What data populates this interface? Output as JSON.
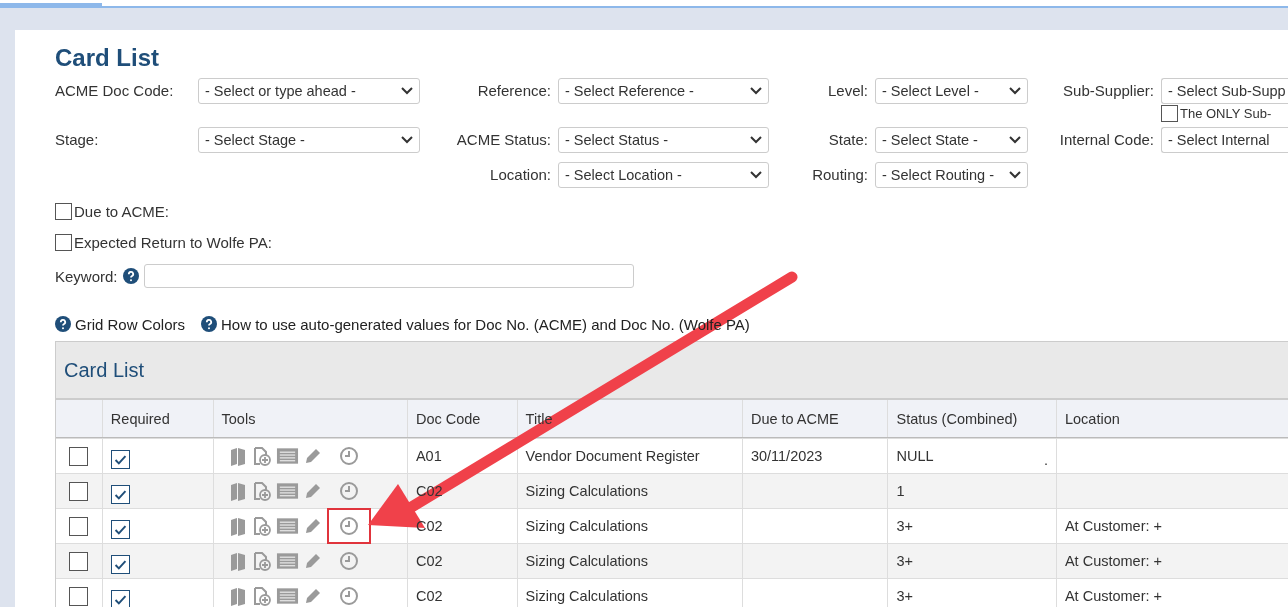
{
  "page_title": "Card List",
  "filter_columns": [
    {
      "fields": [
        {
          "label": "ACME Doc Code:",
          "value": "- Select or type ahead -"
        },
        {
          "label": "Stage:",
          "value": "- Select Stage -"
        }
      ]
    },
    {
      "fields": [
        {
          "label": "Reference:",
          "value": "- Select Reference -"
        },
        {
          "label": "ACME Status:",
          "value": "- Select Status -"
        },
        {
          "label": "Location:",
          "value": "- Select Location -"
        }
      ]
    },
    {
      "fields": [
        {
          "label": "Level:",
          "value": "- Select Level -"
        },
        {
          "label": "State:",
          "value": "- Select State -"
        },
        {
          "label": "Routing:",
          "value": "- Select Routing -"
        }
      ]
    },
    {
      "fields": [
        {
          "label": "Sub-Supplier:",
          "value": "- Select Sub-Supp",
          "extra_checkbox": {
            "label": "The ONLY Sub-",
            "checked": false
          }
        },
        {
          "label": "Internal Code:",
          "value": "- Select Internal"
        }
      ]
    }
  ],
  "checkbox_filters": [
    {
      "label": "Due to ACME:",
      "checked": false
    },
    {
      "label": "Expected Return to Wolfe PA:",
      "checked": false
    }
  ],
  "keyword": {
    "label": "Keyword:"
  },
  "help_links": [
    "Grid Row Colors",
    "How to use auto-generated values for Doc No. (ACME) and Doc No. (Wolfe PA)"
  ],
  "grid": {
    "title": "Card List",
    "columns": [
      "Required",
      "Tools",
      "Doc Code",
      "Title",
      "Due to ACME",
      "Status (Combined)",
      "Location"
    ],
    "rows": [
      {
        "selected": false,
        "required": true,
        "highlighted": false,
        "doc_code": "A01",
        "title": "Vendor Document Register",
        "due": "30/11/2023",
        "status": "NULL",
        "status_note": ".",
        "location": ""
      },
      {
        "selected": false,
        "required": true,
        "highlighted": false,
        "doc_code": "C02",
        "title": "Sizing Calculations",
        "due": "",
        "status": "1",
        "location": ""
      },
      {
        "selected": false,
        "required": true,
        "highlighted": true,
        "doc_code": "C02",
        "title": "Sizing Calculations",
        "due": "",
        "status": "3+",
        "location": "At Customer: +"
      },
      {
        "selected": false,
        "required": true,
        "highlighted": false,
        "doc_code": "C02",
        "title": "Sizing Calculations",
        "due": "",
        "status": "3+",
        "location": "At Customer: +"
      },
      {
        "selected": false,
        "required": true,
        "highlighted": false,
        "doc_code": "C02",
        "title": "Sizing Calculations",
        "due": "",
        "status": "3+",
        "location": "At Customer: +"
      }
    ]
  }
}
